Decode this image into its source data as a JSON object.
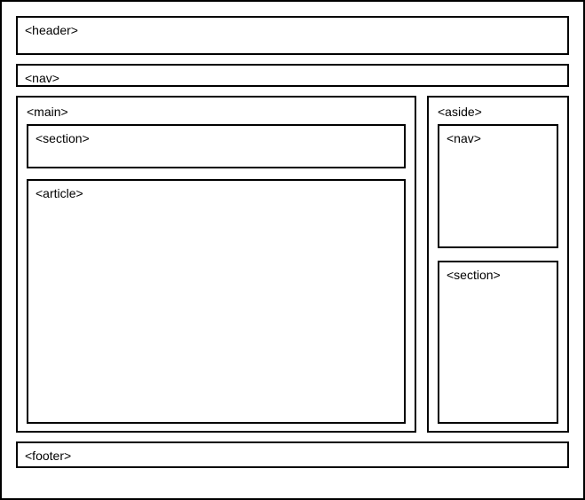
{
  "header": {
    "label": "<header>"
  },
  "nav_top": {
    "label": "<nav>"
  },
  "main": {
    "label": "<main>",
    "section": {
      "label": "<section>"
    },
    "article": {
      "label": "<article>"
    }
  },
  "aside": {
    "label": "<aside>",
    "nav": {
      "label": "<nav>"
    },
    "section": {
      "label": "<section>"
    }
  },
  "footer": {
    "label": "<footer>"
  }
}
